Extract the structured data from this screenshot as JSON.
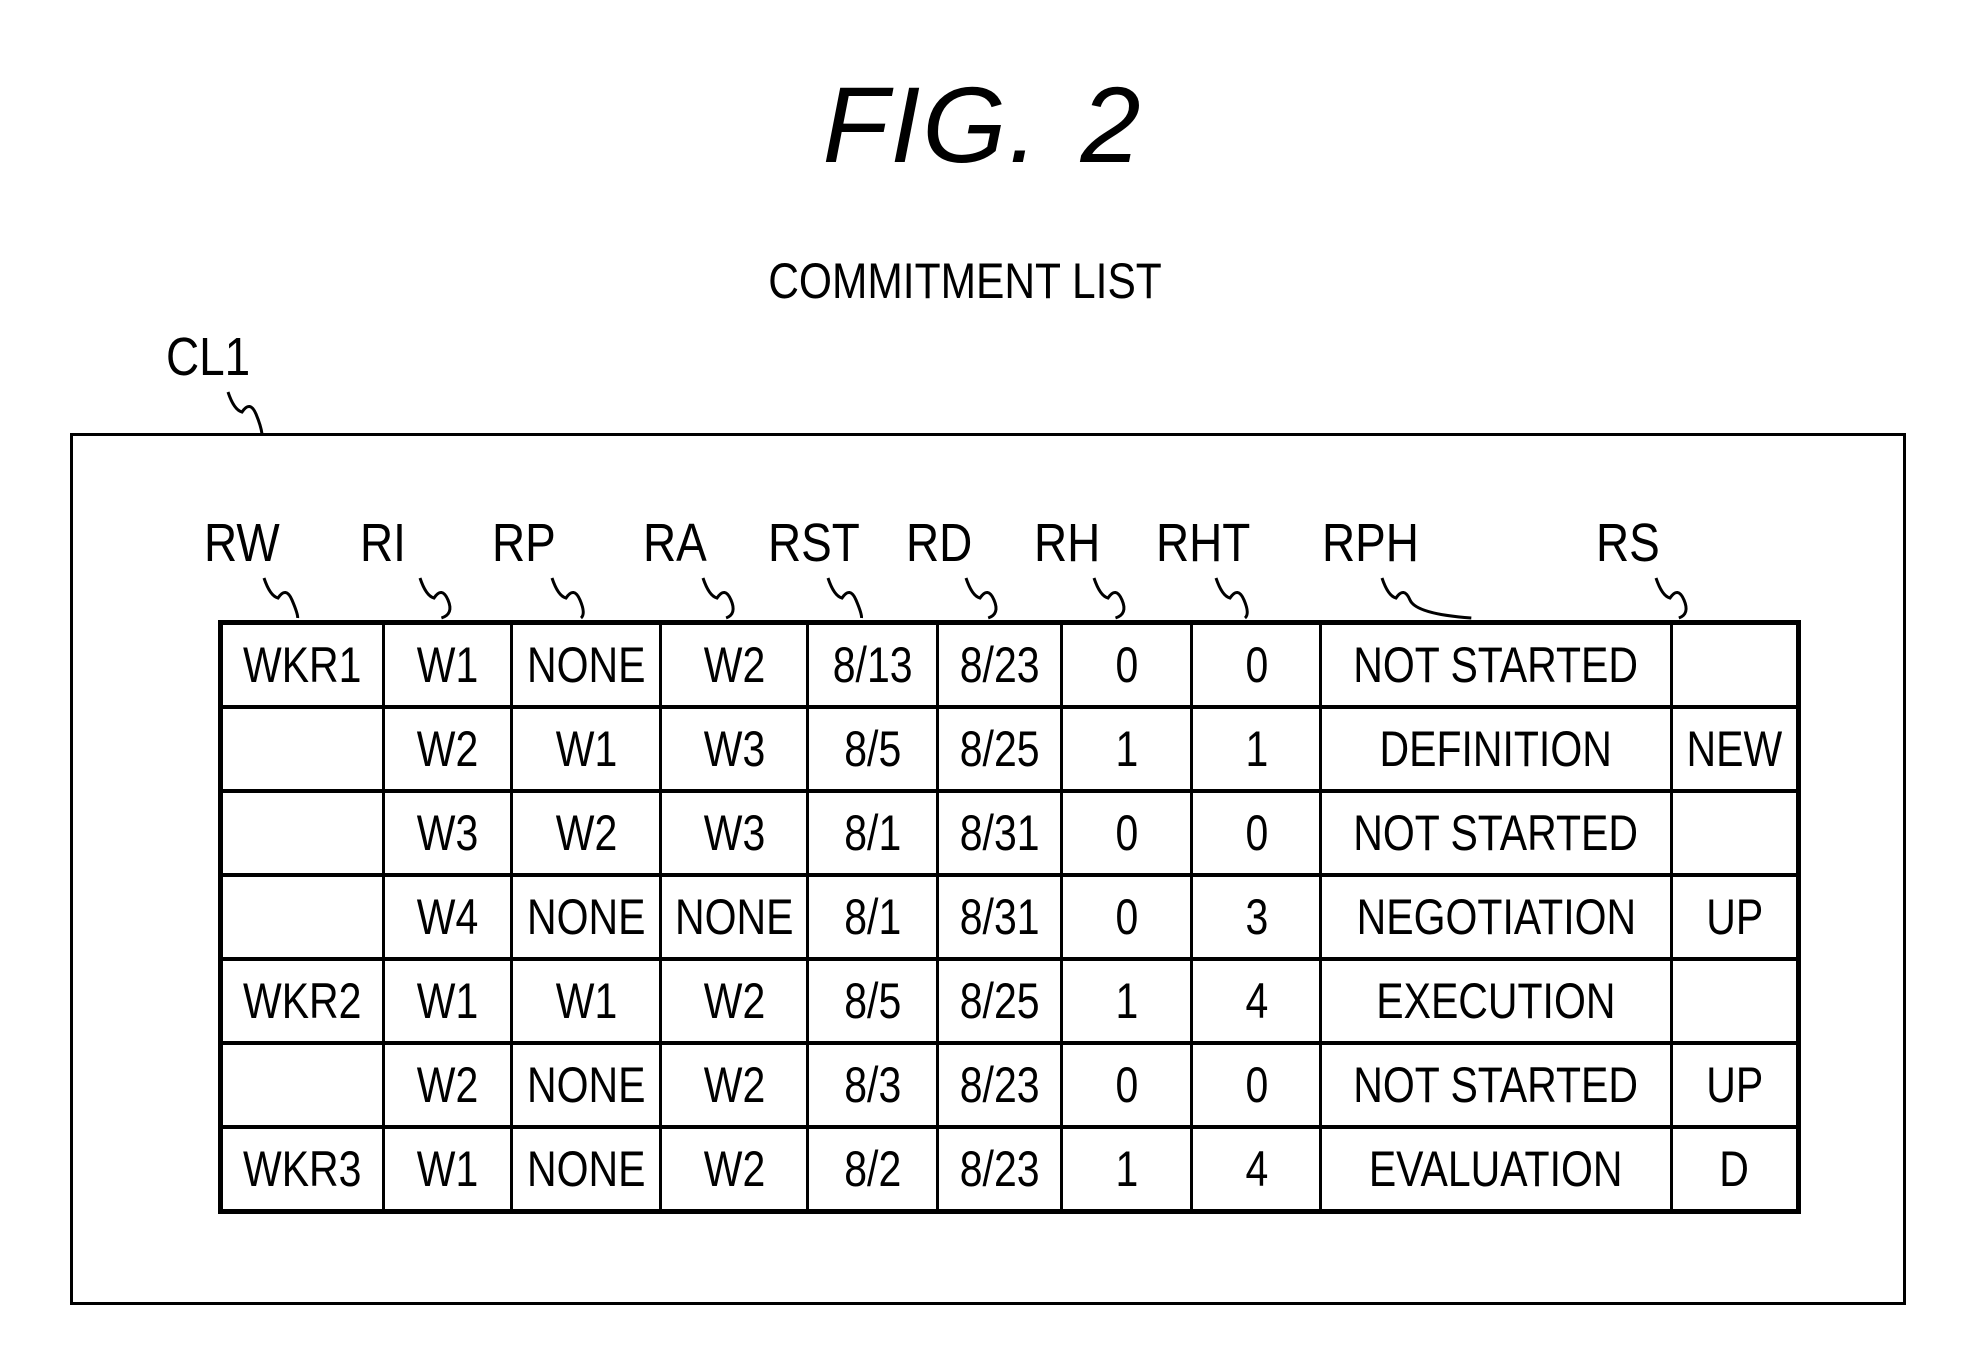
{
  "figure": {
    "label": "FIG.",
    "number": "2"
  },
  "list_title": "COMMITMENT LIST",
  "reference": "CL1",
  "columns": [
    "RW",
    "RI",
    "RP",
    "RA",
    "RST",
    "RD",
    "RH",
    "RHT",
    "RPH",
    "RS"
  ],
  "rows": [
    [
      "WKR1",
      "W1",
      "NONE",
      "W2",
      "8/13",
      "8/23",
      "0",
      "0",
      "NOT STARTED",
      ""
    ],
    [
      "",
      "W2",
      "W1",
      "W3",
      "8/5",
      "8/25",
      "1",
      "1",
      "DEFINITION",
      "NEW"
    ],
    [
      "",
      "W3",
      "W2",
      "W3",
      "8/1",
      "8/31",
      "0",
      "0",
      "NOT STARTED",
      ""
    ],
    [
      "",
      "W4",
      "NONE",
      "NONE",
      "8/1",
      "8/31",
      "0",
      "3",
      "NEGOTIATION",
      "UP"
    ],
    [
      "WKR2",
      "W1",
      "W1",
      "W2",
      "8/5",
      "8/25",
      "1",
      "4",
      "EXECUTION",
      ""
    ],
    [
      "",
      "W2",
      "NONE",
      "W2",
      "8/3",
      "8/23",
      "0",
      "0",
      "NOT STARTED",
      "UP"
    ],
    [
      "WKR3",
      "W1",
      "NONE",
      "W2",
      "8/2",
      "8/23",
      "1",
      "4",
      "EVALUATION",
      "D"
    ]
  ]
}
